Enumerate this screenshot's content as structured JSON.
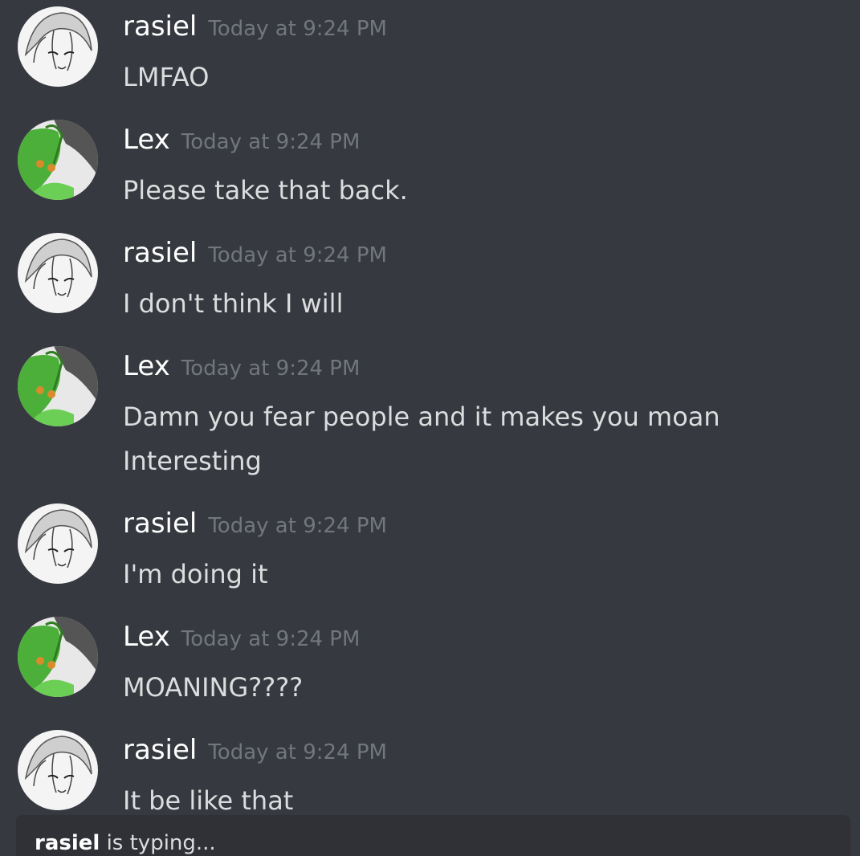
{
  "messages": [
    {
      "author": "rasiel",
      "timestamp": "Today at 9:24 PM",
      "avatar": "rasiel",
      "lines": [
        "LMFAO"
      ]
    },
    {
      "author": "Lex",
      "timestamp": "Today at 9:24 PM",
      "avatar": "lex",
      "lines": [
        "Please take that back."
      ]
    },
    {
      "author": "rasiel",
      "timestamp": "Today at 9:24 PM",
      "avatar": "rasiel",
      "lines": [
        "I don't think I will"
      ]
    },
    {
      "author": "Lex",
      "timestamp": "Today at 9:24 PM",
      "avatar": "lex",
      "lines": [
        "Damn you fear people and it makes you moan",
        "Interesting"
      ]
    },
    {
      "author": "rasiel",
      "timestamp": "Today at 9:24 PM",
      "avatar": "rasiel",
      "lines": [
        "I'm doing it"
      ]
    },
    {
      "author": "Lex",
      "timestamp": "Today at 9:24 PM",
      "avatar": "lex",
      "lines": [
        "MOANING????"
      ]
    },
    {
      "author": "rasiel",
      "timestamp": "Today at 9:24 PM",
      "avatar": "rasiel",
      "lines": [
        "It be like that"
      ]
    }
  ],
  "typing": {
    "user": "rasiel",
    "text": " is typing..."
  },
  "colors": {
    "background": "#36393f",
    "typing_bar": "#2f3136",
    "author": "#ffffff",
    "timestamp": "#72767d",
    "message_text": "#dcddde",
    "lex_avatar_green": "#4caf3a"
  }
}
